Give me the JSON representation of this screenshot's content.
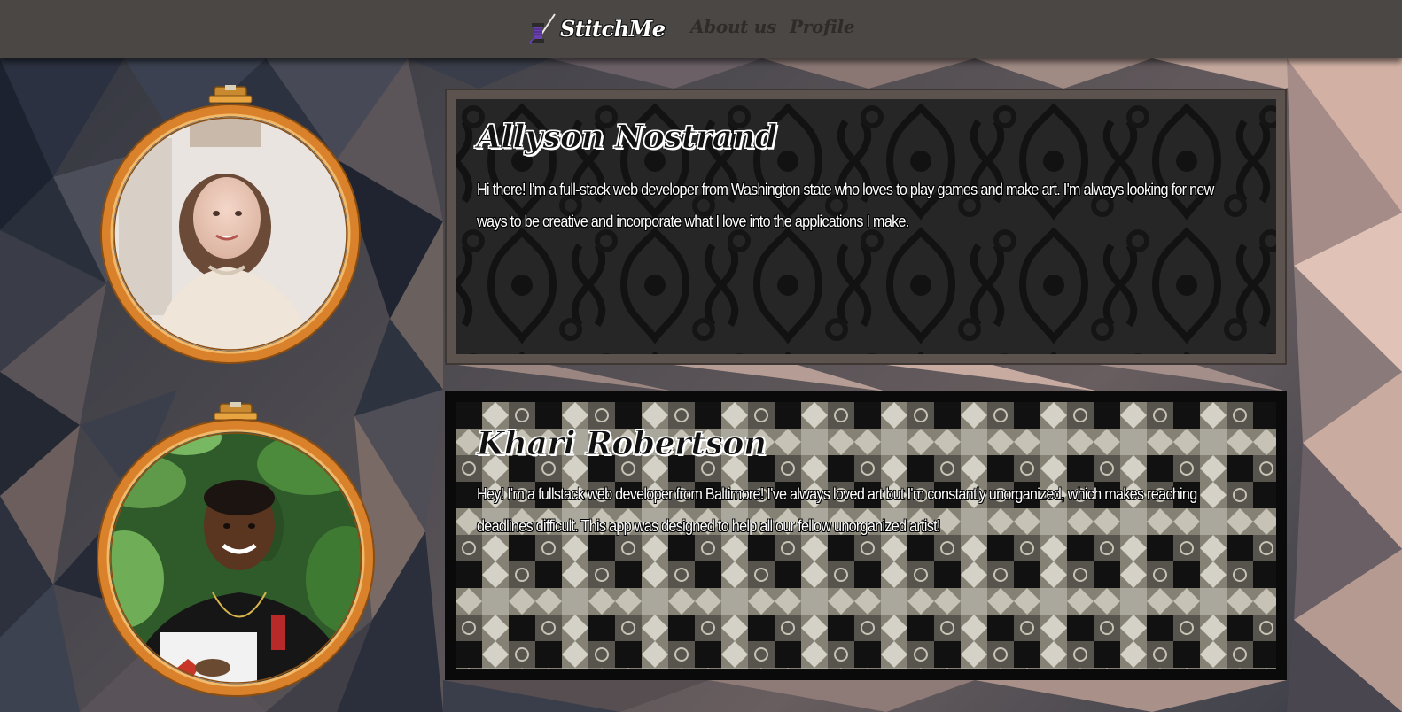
{
  "nav": {
    "brand": "StitchMe",
    "brand_icon": "spool-needle-icon",
    "links": [
      {
        "label": "About us"
      },
      {
        "label": "Profile"
      }
    ]
  },
  "team": [
    {
      "name": "Allyson Nostrand",
      "bio": "Hi there! I'm a full-stack web developer from Washington state who loves to play games and make art. I'm always looking for new ways to be creative and incorporate what I love into the applications I make.",
      "photo": "portrait-photo-allyson"
    },
    {
      "name": "Khari Robertson",
      "bio": "Hey! I'm a fullstack web developer from Baltimore! I've always loved art but I'm constantly unorganized, which makes reaching deadlines difficult. This app was designed to help all our fellow unorganized artist!",
      "photo": "portrait-photo-khari"
    }
  ],
  "colors": {
    "navbar": "#4a4744",
    "hoop_wood": "#d9822b",
    "card_1_frame": "#5d534e",
    "card_2_frame": "#0a0a0a",
    "heading_text": "#111111",
    "bio_text": "#ffffff"
  }
}
